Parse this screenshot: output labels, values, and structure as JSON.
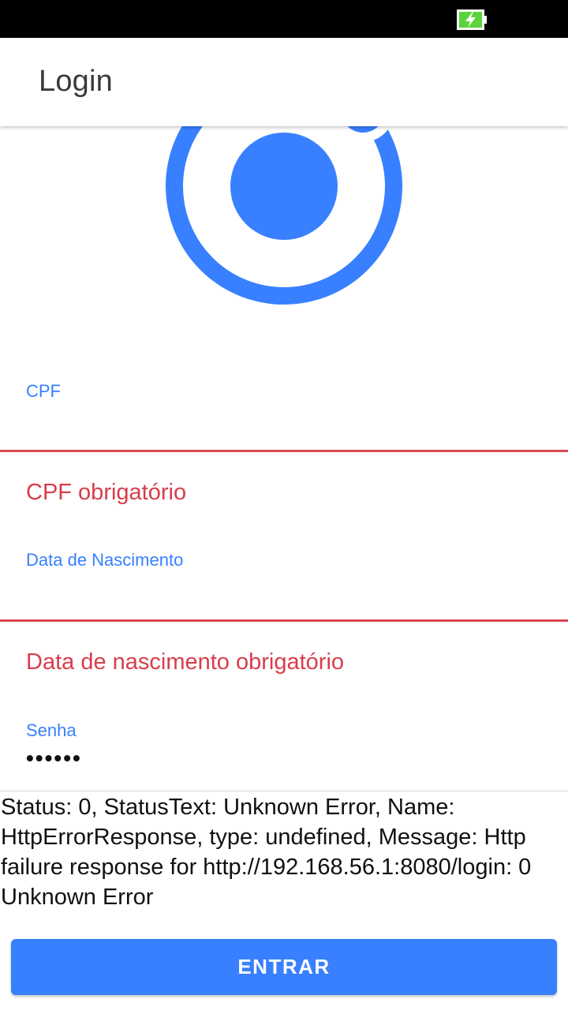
{
  "toolbar": {
    "title": "Login"
  },
  "form": {
    "cpf": {
      "label": "CPF",
      "value": "",
      "error": "CPF obrigatório"
    },
    "birthdate": {
      "label": "Data de Nascimento",
      "value": "",
      "error": "Data de nascimento obrigatório"
    },
    "password": {
      "label": "Senha",
      "masked_value": "••••••"
    }
  },
  "error_message": "Status: 0, StatusText: Unknown Error, Name: HttpErrorResponse, type: undefined, Message: Http failure response for http://192.168.56.1:8080/login: 0 Unknown Error",
  "login_button": {
    "label": "ENTRAR"
  },
  "colors": {
    "accent": "#3880ff",
    "error": "#d83d4a",
    "status_bar": "#000000",
    "battery": "#5bd33b"
  },
  "icons": {
    "battery": "battery-charging-icon",
    "logo": "ionic-logo"
  }
}
